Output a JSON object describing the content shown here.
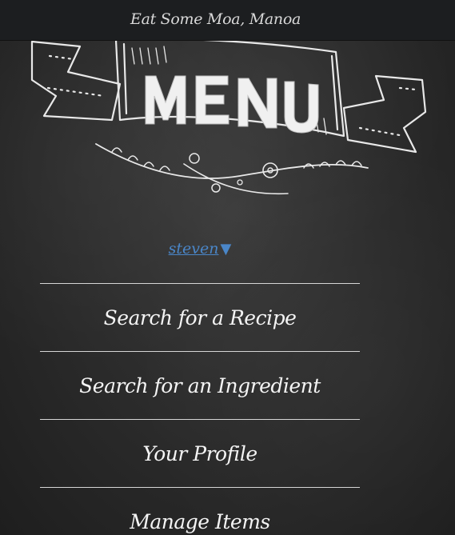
{
  "navbar": {
    "brand": "Eat Some Moa, Manoa"
  },
  "hero": {
    "banner_text": "MENU",
    "banner_icon": "chalk-banner-icon"
  },
  "user": {
    "name": "steven",
    "caret": "▼"
  },
  "menu": {
    "items": [
      {
        "label": "Search for a Recipe"
      },
      {
        "label": "Search for an Ingredient"
      },
      {
        "label": "Your Profile"
      },
      {
        "label": "Manage Items"
      }
    ]
  },
  "colors": {
    "background": "#2c2c2c",
    "navbar": "#1c1e20",
    "link": "#4a86c8",
    "chalk": "#f2f2f2"
  }
}
